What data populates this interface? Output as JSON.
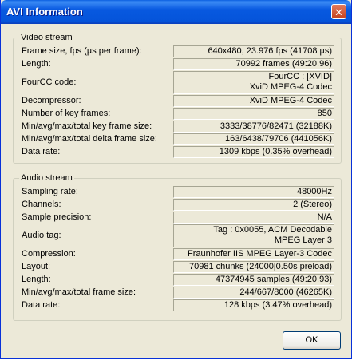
{
  "window": {
    "title": "AVI Information",
    "close_glyph": "✕"
  },
  "video": {
    "heading": "Video stream",
    "rows": [
      {
        "label": "Frame size, fps (µs per frame):",
        "value": "640x480, 23.976 fps (41708 µs)"
      },
      {
        "label": "Length:",
        "value": "70992 frames (49:20.96)"
      },
      {
        "label": "FourCC code:",
        "value": "FourCC : [XVID]\nXviD MPEG-4 Codec"
      },
      {
        "label": "Decompressor:",
        "value": "XviD MPEG-4 Codec"
      },
      {
        "label": "Number of key frames:",
        "value": "850"
      },
      {
        "label": "Min/avg/max/total key frame size:",
        "value": "3333/38776/82471 (32188K)"
      },
      {
        "label": "Min/avg/max/total delta frame size:",
        "value": "163/6438/79706 (441056K)"
      },
      {
        "label": "Data rate:",
        "value": "1309 kbps (0.35% overhead)"
      }
    ]
  },
  "audio": {
    "heading": "Audio stream",
    "rows": [
      {
        "label": "Sampling rate:",
        "value": "48000Hz"
      },
      {
        "label": "Channels:",
        "value": "2 (Stereo)"
      },
      {
        "label": "Sample precision:",
        "value": "N/A"
      },
      {
        "label": "Audio tag:",
        "value": "Tag : 0x0055, ACM Decodable\nMPEG Layer 3"
      },
      {
        "label": "Compression:",
        "value": "Fraunhofer IIS MPEG Layer-3 Codec"
      },
      {
        "label": "Layout:",
        "value": "70981 chunks (24000|0.50s preload)"
      },
      {
        "label": "Length:",
        "value": "47374945 samples (49:20.93)"
      },
      {
        "label": "Min/avg/max/total frame size:",
        "value": "244/667/8000 (46265K)"
      },
      {
        "label": "Data rate:",
        "value": "128 kbps (3.47% overhead)"
      }
    ]
  },
  "buttons": {
    "ok": "OK"
  }
}
